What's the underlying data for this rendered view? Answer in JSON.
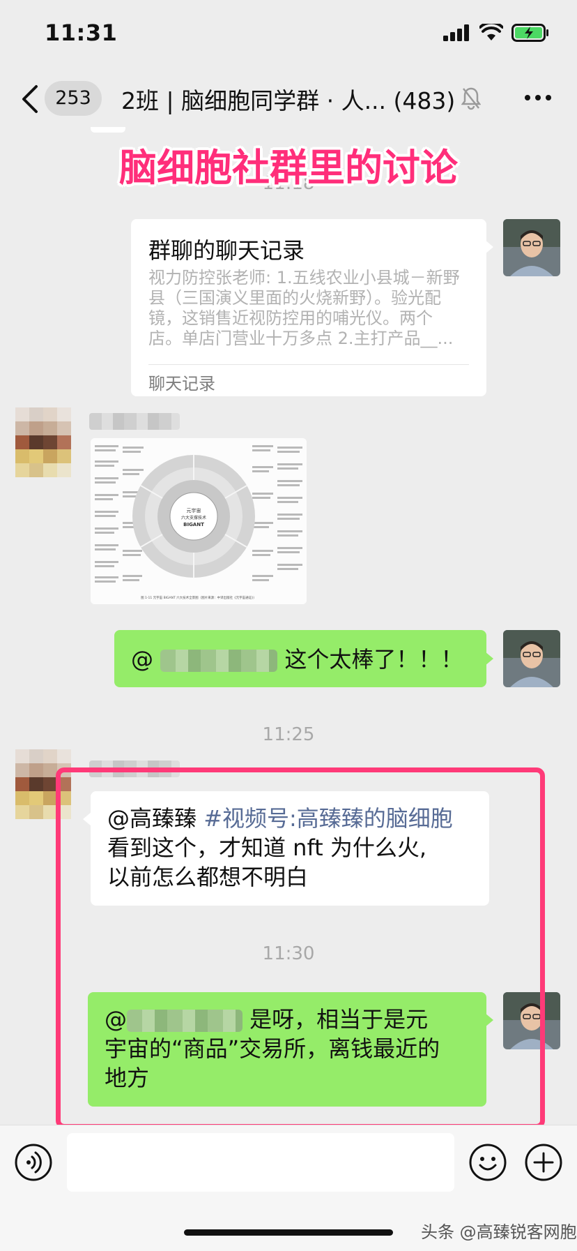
{
  "status_bar": {
    "time": "11:31"
  },
  "nav": {
    "unread_count": "253",
    "title": "2班 | 脑细胞同学群 · 人... (483)"
  },
  "overlay": {
    "caption": "脑细胞社群里的讨论"
  },
  "times": {
    "t1": "11:18",
    "t2": "11:25",
    "t3": "11:30"
  },
  "chat_record_card": {
    "title": "群聊的聊天记录",
    "preview_lines": [
      "视力防控张老师: 1.五线农业小县城－新野",
      "县（三国演义里面的火烧新野）。验光配",
      "镜，这销售近视防控用的哺光仪。两个",
      "店。单店门营业十万多点 2.主打产品__..."
    ],
    "footer": "聊天记录"
  },
  "image_message": {
    "center_title": "元宇宙",
    "center_sub": "六大支撑技术",
    "center_brand": "BIGANT",
    "caption": "图 1-11   元宇宙 BIGANT 六大技术全景图（图片来源：中译出版社《元宇宙通证》）"
  },
  "messages": {
    "m1_prefix": "@",
    "m1_text": "这个太棒了！！！",
    "m2_mention": "@高臻臻",
    "m2_link": "#视频号:高臻臻的脑细胞",
    "m2_line1": "看到这个，才知道 nft 为什么火,",
    "m2_line2": "以前怎么都想不明白",
    "m3_prefix": "@",
    "m3_line1": "是呀，相当于是元",
    "m3_line2": "宇宙的“商品”交易所，离钱最近的",
    "m3_line3": "地方"
  },
  "watermark": "头条 @高臻锐客网胞"
}
